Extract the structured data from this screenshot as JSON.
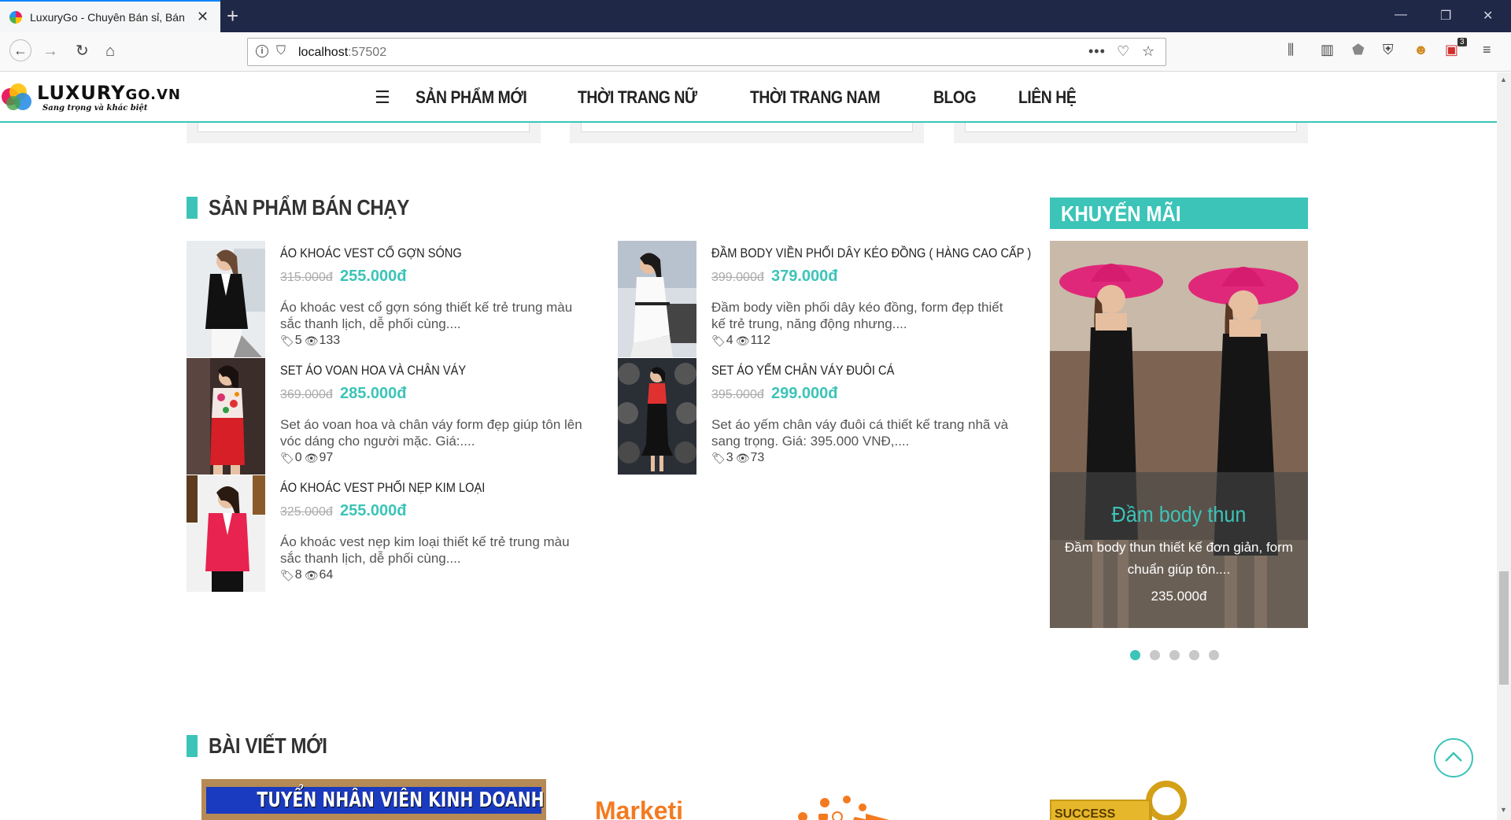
{
  "browser": {
    "tab_title": "LuxuryGo - Chuyên Bán sỉ, Bán",
    "url_host": "localhost",
    "url_port": ":57502",
    "extension_badge": "3"
  },
  "site": {
    "logo_text": "LUXURY",
    "logo_suffix": "GO.VN",
    "logo_tagline": "Sang trọng và khác biệt",
    "menu": [
      "SẢN PHẨM MỚI",
      "THỜI TRANG NỮ",
      "THỜI TRANG NAM",
      "BLOG",
      "LIÊN HỆ"
    ]
  },
  "bestsellers": {
    "title": "SẢN PHẨM BÁN CHẠY",
    "items": [
      {
        "name": "ÁO KHOÁC VEST CỔ GỢN SÓNG",
        "old_price": "315.000đ",
        "price": "255.000đ",
        "desc": "Áo khoác vest cổ gợn sóng thiết kế trẻ trung màu sắc thanh lịch, dễ phối cùng....",
        "tags": "5",
        "views": "133"
      },
      {
        "name": "ĐẦM BODY VIỀN PHỐI DÂY KÉO ĐỒNG ( HÀNG CAO CẤP )",
        "old_price": "399.000đ",
        "price": "379.000đ",
        "desc": "Đầm body viền phối dây kéo đồng, form đẹp thiết kế trẻ trung, năng động nhưng....",
        "tags": "4",
        "views": "112"
      },
      {
        "name": "SET ÁO VOAN HOA VÀ CHÂN VÁY",
        "old_price": "369.000đ",
        "price": "285.000đ",
        "desc": "Set áo voan hoa và chân váy form đẹp giúp tôn lên vóc dáng cho người mặc. Giá:....",
        "tags": "0",
        "views": "97"
      },
      {
        "name": "SET ÁO YẾM CHÂN VÁY ĐUÔI CÁ",
        "old_price": "395.000đ",
        "price": "299.000đ",
        "desc": "Set áo yếm chân váy đuôi cá thiết kế trang nhã và sang trọng. Giá: 395.000 VNĐ,....",
        "tags": "3",
        "views": "73"
      },
      {
        "name": "ÁO KHOÁC VEST PHỐI NẸP KIM LOẠI",
        "old_price": "325.000đ",
        "price": "255.000đ",
        "desc": "Áo khoác vest nẹp kim loại thiết kế trẻ trung màu sắc thanh lịch, dễ phối cùng....",
        "tags": "8",
        "views": "64"
      }
    ]
  },
  "promo": {
    "title": "KHUYẾN MÃI",
    "name": "Đầm body thun",
    "desc": "Đầm body thun thiết kế đơn giản, form chuẩn giúp tôn....",
    "price": "235.000đ",
    "slide_count": 5,
    "active_slide": 1
  },
  "blog": {
    "title": "BÀI VIẾT MỚI",
    "banner_text": "TUYỂN NHÂN VIÊN KINH DOANH ONLINE",
    "marketing_text": "Marketi",
    "key_text": "SUCCESS"
  },
  "colors": {
    "accent": "#3cc4b8",
    "tabbar": "#1f2847"
  }
}
